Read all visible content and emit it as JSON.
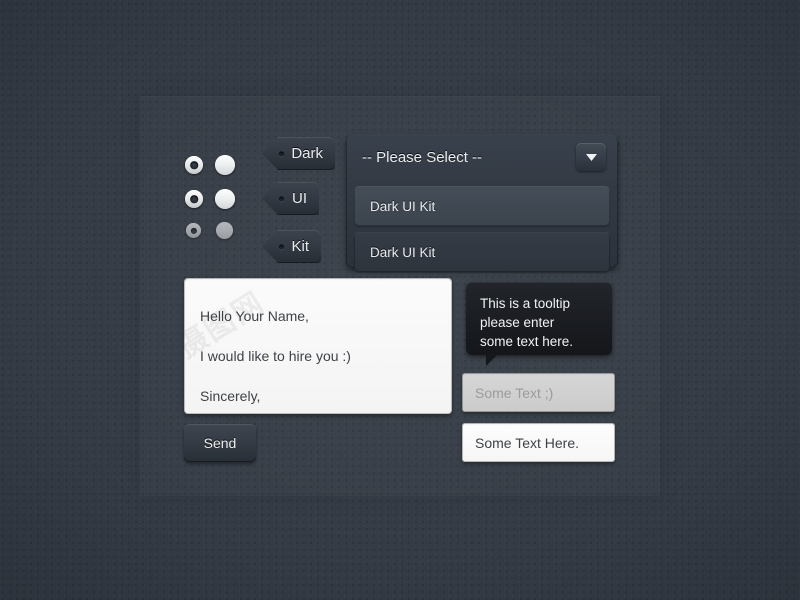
{
  "meta": {
    "background_color": "#343b45",
    "accent_dark": "#2c323b",
    "text_light": "#e9ebee",
    "text_dark": "#3e4247"
  },
  "radios": {
    "rows": [
      {
        "checked_label": "radio-checked-1",
        "plain_label": "radio-plain-1",
        "state": "normal"
      },
      {
        "checked_label": "radio-checked-2",
        "plain_label": "radio-plain-2",
        "state": "normal"
      },
      {
        "checked_label": "radio-checked-3",
        "plain_label": "radio-plain-3",
        "state": "disabled"
      }
    ]
  },
  "tags": [
    {
      "label": "Dark"
    },
    {
      "label": "UI"
    },
    {
      "label": "Kit"
    }
  ],
  "dropdown": {
    "selected_label": "-- Please Select --",
    "arrow_icon": "chevron-down-icon",
    "options": [
      {
        "label": "Dark UI Kit",
        "state": "hover"
      },
      {
        "label": "Dark UI Kit",
        "state": "normal"
      }
    ]
  },
  "message": {
    "lines": [
      "Hello Your Name,",
      "I would like to hire you :)",
      "Sincerely,"
    ],
    "watermark": "摄图网"
  },
  "send_button": {
    "label": "Send"
  },
  "tooltip": {
    "lines": [
      "This is a tooltip",
      "please enter",
      "some text here."
    ]
  },
  "inputs": {
    "disabled_field": {
      "placeholder": "Some Text ;)",
      "value": ""
    },
    "active_field": {
      "value": "Some Text Here.",
      "placeholder": "Some Text Here."
    }
  }
}
